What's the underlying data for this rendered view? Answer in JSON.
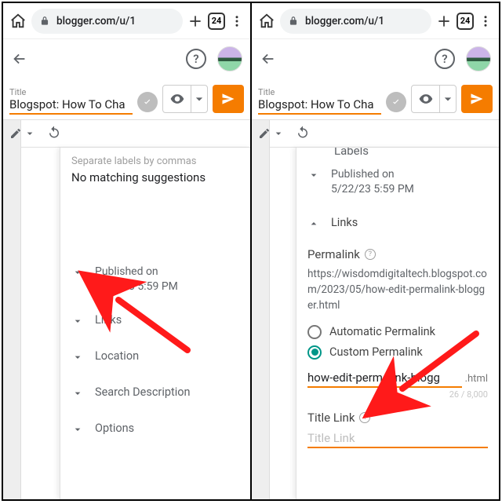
{
  "browser": {
    "url": "blogger.com/u/1",
    "tab_count": "24"
  },
  "editor": {
    "title_label": "Title",
    "title_value": "Blogspot: How To Cha"
  },
  "left_panel": {
    "labels_hint": "Separate labels by commas",
    "no_match": "No matching suggestions",
    "published_label": "Published on",
    "published_value": "5/22/23 5:59 PM",
    "links": "Links",
    "location": "Location",
    "search_desc": "Search Description",
    "options": "Options"
  },
  "right_panel": {
    "labels_partial": "Labels",
    "published_label": "Published on",
    "published_value": "5/22/23 5:59 PM",
    "links": "Links",
    "permalink_label": "Permalink",
    "permalink_url": "https://wisdomdigitaltech.blogspot.com/2023/05/how-edit-permalink-blogger.html",
    "auto_label": "Automatic Permalink",
    "custom_label": "Custom Permalink",
    "custom_value": "how-edit-permalink-blogg",
    "custom_ext": ".html",
    "counter": "26 / 8,000",
    "title_link_label": "Title Link",
    "title_link_placeholder": "Title Link"
  }
}
